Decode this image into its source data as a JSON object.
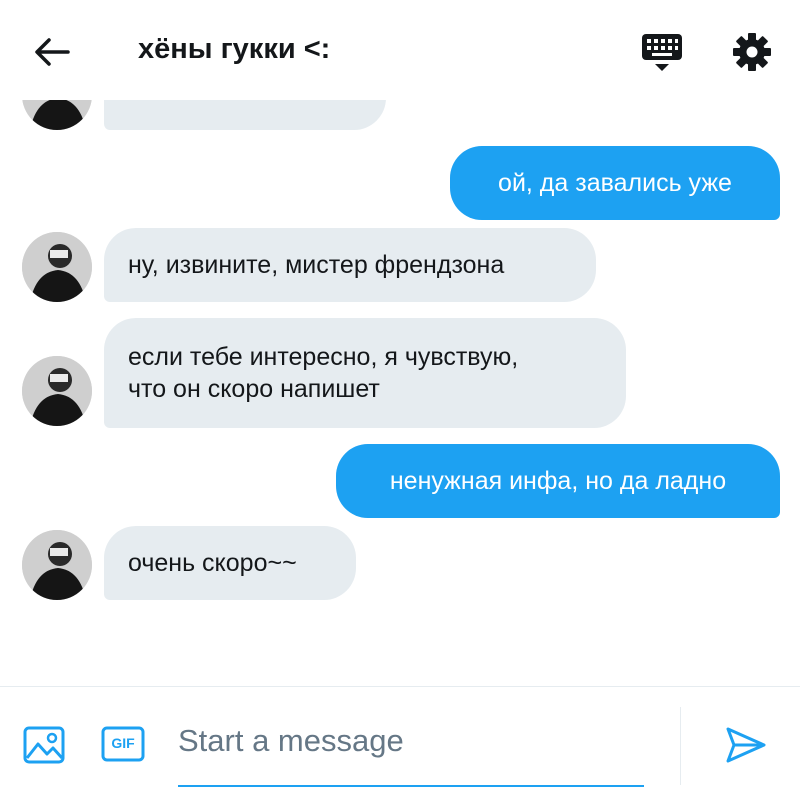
{
  "header": {
    "title": "хёны гукки <:",
    "back_icon": "arrow-left-icon",
    "keyboard_icon": "keyboard-icon",
    "settings_icon": "gear-icon"
  },
  "messages": [
    {
      "direction": "in",
      "text": ""
    },
    {
      "direction": "out",
      "text": "ой, да завались уже"
    },
    {
      "direction": "in",
      "text": "ну, извините, мистер френдзона"
    },
    {
      "direction": "in",
      "lines": [
        "если тебе интересно, я чувствую,",
        "что он скоро напишет"
      ]
    },
    {
      "direction": "out",
      "text": "ненужная инфа, но да ладно"
    },
    {
      "direction": "in",
      "text": "очень скоро~~"
    }
  ],
  "composer": {
    "placeholder": "Start a message",
    "media_icon": "image-icon",
    "gif_label": "GIF",
    "send_icon": "send-icon"
  },
  "colors": {
    "accent": "#1da1f2",
    "incoming_bubble": "#e6ecf0",
    "text": "#14171a",
    "placeholder": "#657786"
  }
}
